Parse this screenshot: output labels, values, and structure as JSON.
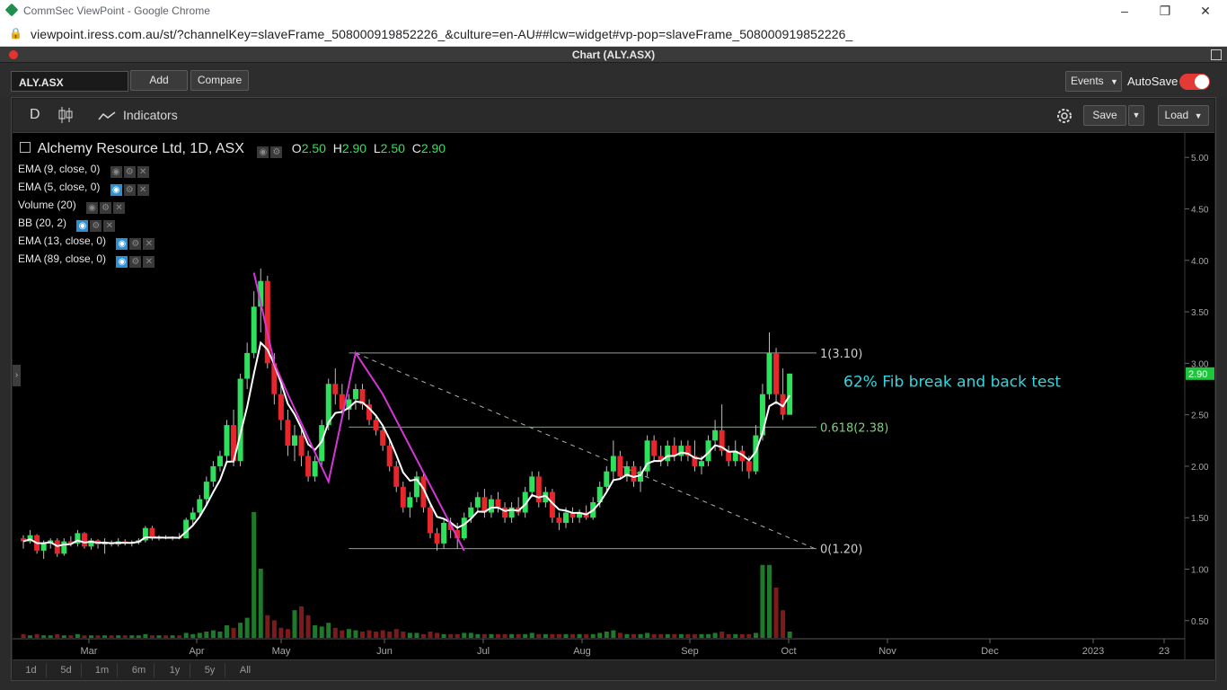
{
  "browser": {
    "window_title": "CommSec ViewPoint - Google Chrome",
    "url": "viewpoint.iress.com.au/st/?channelKey=slaveFrame_508000919852226_&culture=en-AU##lcw=widget#vp-pop=slaveFrame_508000919852226_"
  },
  "app": {
    "panel_title": "Chart (ALY.ASX)"
  },
  "toolbar": {
    "symbol": "ALY.ASX",
    "add_label": "Add",
    "compare_label": "Compare",
    "events_label": "Events",
    "autosave_label": "AutoSave",
    "autosave_on": true
  },
  "chart_toolbar": {
    "interval": "D",
    "indicators_label": "Indicators",
    "save_label": "Save",
    "load_label": "Load"
  },
  "legend": {
    "instrument": "Alchemy Resource Ltd, 1D, ASX",
    "ohlc": {
      "o_label": "O",
      "o": "2.50",
      "h_label": "H",
      "h": "2.90",
      "l_label": "L",
      "l": "2.50",
      "c_label": "C",
      "c": "2.90"
    },
    "studies": [
      {
        "label": "EMA (9, close, 0)",
        "visible": false
      },
      {
        "label": "EMA (5, close, 0)",
        "visible": true
      },
      {
        "label": "Volume (20)",
        "visible": false
      },
      {
        "label": "BB (20, 2)",
        "visible": true
      },
      {
        "label": "EMA (13, close, 0)",
        "visible": true
      },
      {
        "label": "EMA (89, close, 0)",
        "visible": true
      }
    ]
  },
  "range_buttons": [
    "1d",
    "5d",
    "1m",
    "6m",
    "1y",
    "5y",
    "All"
  ],
  "colors": {
    "up": "#2ee05c",
    "down": "#e8262c",
    "ema": "#ffffff",
    "trend": "#d636d6",
    "fib_text": "#cfcfcf",
    "annotation": "#2fd8e0",
    "price_tag": "#20c53e"
  },
  "chart_data": {
    "type": "candlestick",
    "y_ticks": [
      "5.00",
      "4.50",
      "4.00",
      "3.50",
      "3.00",
      "2.50",
      "2.00",
      "1.50",
      "1.00",
      "0.50"
    ],
    "ylim": [
      0.35,
      5.15
    ],
    "x_ticks": [
      "Mar",
      "Apr",
      "May",
      "Jun",
      "Jul",
      "Aug",
      "Sep",
      "Oct",
      "Nov",
      "Dec",
      "2023",
      "23"
    ],
    "last_price": "2.90",
    "fib_levels": [
      {
        "label": "1(3.10)",
        "value": 3.1
      },
      {
        "label": "0.618(2.38)",
        "value": 2.38
      },
      {
        "label": "0(1.20)",
        "value": 1.2
      }
    ],
    "annotation": "62% Fib break and back test",
    "candles": [
      [
        1.3,
        1.33,
        1.2,
        1.27
      ],
      [
        1.27,
        1.38,
        1.25,
        1.33
      ],
      [
        1.33,
        1.34,
        1.15,
        1.18
      ],
      [
        1.18,
        1.28,
        1.1,
        1.25
      ],
      [
        1.25,
        1.3,
        1.2,
        1.28
      ],
      [
        1.28,
        1.3,
        1.12,
        1.15
      ],
      [
        1.15,
        1.3,
        1.13,
        1.27
      ],
      [
        1.27,
        1.32,
        1.22,
        1.25
      ],
      [
        1.25,
        1.38,
        1.22,
        1.35
      ],
      [
        1.35,
        1.36,
        1.2,
        1.22
      ],
      [
        1.22,
        1.3,
        1.19,
        1.28
      ],
      [
        1.28,
        1.29,
        1.2,
        1.24
      ],
      [
        1.24,
        1.3,
        1.15,
        1.26
      ],
      [
        1.26,
        1.28,
        1.22,
        1.24
      ],
      [
        1.24,
        1.3,
        1.22,
        1.27
      ],
      [
        1.27,
        1.29,
        1.23,
        1.25
      ],
      [
        1.25,
        1.28,
        1.22,
        1.26
      ],
      [
        1.26,
        1.3,
        1.24,
        1.28
      ],
      [
        1.28,
        1.42,
        1.26,
        1.4
      ],
      [
        1.4,
        1.42,
        1.28,
        1.3
      ],
      [
        1.3,
        1.33,
        1.28,
        1.31
      ],
      [
        1.31,
        1.33,
        1.29,
        1.3
      ],
      [
        1.3,
        1.32,
        1.28,
        1.31
      ],
      [
        1.31,
        1.35,
        1.29,
        1.3
      ],
      [
        1.3,
        1.5,
        1.3,
        1.48
      ],
      [
        1.48,
        1.6,
        1.42,
        1.55
      ],
      [
        1.55,
        1.72,
        1.5,
        1.68
      ],
      [
        1.68,
        1.9,
        1.62,
        1.85
      ],
      [
        1.85,
        2.05,
        1.8,
        2.0
      ],
      [
        2.0,
        2.15,
        1.95,
        2.1
      ],
      [
        2.1,
        2.45,
        2.05,
        2.4
      ],
      [
        2.4,
        2.55,
        2.0,
        2.05
      ],
      [
        2.05,
        2.9,
        2.0,
        2.85
      ],
      [
        2.85,
        3.2,
        2.75,
        3.1
      ],
      [
        3.1,
        3.7,
        3.05,
        3.55
      ],
      [
        3.55,
        3.92,
        3.3,
        3.8
      ],
      [
        3.8,
        3.85,
        2.95,
        3.0
      ],
      [
        3.0,
        3.1,
        2.6,
        2.7
      ],
      [
        2.7,
        2.8,
        2.35,
        2.45
      ],
      [
        2.45,
        2.55,
        2.1,
        2.2
      ],
      [
        2.2,
        2.4,
        2.05,
        2.3
      ],
      [
        2.3,
        2.35,
        2.0,
        2.1
      ],
      [
        2.1,
        2.15,
        1.85,
        1.9
      ],
      [
        1.9,
        2.1,
        1.85,
        2.05
      ],
      [
        2.05,
        2.45,
        2.0,
        2.4
      ],
      [
        2.4,
        2.85,
        2.35,
        2.8
      ],
      [
        2.8,
        2.95,
        2.6,
        2.7
      ],
      [
        2.7,
        2.8,
        2.5,
        2.55
      ],
      [
        2.55,
        2.7,
        2.45,
        2.65
      ],
      [
        2.65,
        2.8,
        2.55,
        2.75
      ],
      [
        2.75,
        2.8,
        2.55,
        2.6
      ],
      [
        2.6,
        2.65,
        2.4,
        2.45
      ],
      [
        2.45,
        2.5,
        2.3,
        2.35
      ],
      [
        2.35,
        2.4,
        2.15,
        2.2
      ],
      [
        2.2,
        2.25,
        1.95,
        2.0
      ],
      [
        2.0,
        2.05,
        1.75,
        1.8
      ],
      [
        1.8,
        1.85,
        1.55,
        1.6
      ],
      [
        1.6,
        1.75,
        1.5,
        1.7
      ],
      [
        1.7,
        1.95,
        1.65,
        1.9
      ],
      [
        1.9,
        1.95,
        1.55,
        1.6
      ],
      [
        1.6,
        1.62,
        1.3,
        1.35
      ],
      [
        1.35,
        1.4,
        1.18,
        1.25
      ],
      [
        1.25,
        1.48,
        1.2,
        1.45
      ],
      [
        1.45,
        1.5,
        1.3,
        1.38
      ],
      [
        1.38,
        1.45,
        1.2,
        1.3
      ],
      [
        1.3,
        1.55,
        1.28,
        1.5
      ],
      [
        1.5,
        1.65,
        1.45,
        1.6
      ],
      [
        1.6,
        1.75,
        1.55,
        1.7
      ],
      [
        1.7,
        1.78,
        1.5,
        1.55
      ],
      [
        1.55,
        1.72,
        1.5,
        1.68
      ],
      [
        1.68,
        1.75,
        1.55,
        1.6
      ],
      [
        1.6,
        1.65,
        1.45,
        1.5
      ],
      [
        1.5,
        1.65,
        1.45,
        1.6
      ],
      [
        1.6,
        1.7,
        1.52,
        1.55
      ],
      [
        1.55,
        1.8,
        1.5,
        1.75
      ],
      [
        1.75,
        1.95,
        1.7,
        1.9
      ],
      [
        1.9,
        1.95,
        1.6,
        1.65
      ],
      [
        1.65,
        1.8,
        1.6,
        1.75
      ],
      [
        1.75,
        1.78,
        1.45,
        1.5
      ],
      [
        1.5,
        1.55,
        1.38,
        1.45
      ],
      [
        1.45,
        1.6,
        1.4,
        1.55
      ],
      [
        1.55,
        1.6,
        1.45,
        1.5
      ],
      [
        1.5,
        1.58,
        1.45,
        1.55
      ],
      [
        1.55,
        1.62,
        1.48,
        1.5
      ],
      [
        1.5,
        1.7,
        1.48,
        1.65
      ],
      [
        1.65,
        1.85,
        1.6,
        1.8
      ],
      [
        1.8,
        2.0,
        1.75,
        1.95
      ],
      [
        1.95,
        2.25,
        1.85,
        2.1
      ],
      [
        2.1,
        2.15,
        1.88,
        1.9
      ],
      [
        1.9,
        2.05,
        1.85,
        2.0
      ],
      [
        2.0,
        2.05,
        1.8,
        1.85
      ],
      [
        1.85,
        2.0,
        1.75,
        1.95
      ],
      [
        1.95,
        2.3,
        1.9,
        2.25
      ],
      [
        2.25,
        2.3,
        2.05,
        2.1
      ],
      [
        2.1,
        2.2,
        2.0,
        2.05
      ],
      [
        2.05,
        2.25,
        2.0,
        2.2
      ],
      [
        2.2,
        2.28,
        2.05,
        2.1
      ],
      [
        2.1,
        2.25,
        2.05,
        2.2
      ],
      [
        2.2,
        2.25,
        2.05,
        2.1
      ],
      [
        2.1,
        2.25,
        1.95,
        2.0
      ],
      [
        2.0,
        2.1,
        1.92,
        2.05
      ],
      [
        2.05,
        2.3,
        2.0,
        2.25
      ],
      [
        2.25,
        2.45,
        2.15,
        2.35
      ],
      [
        2.35,
        2.6,
        2.1,
        2.15
      ],
      [
        2.15,
        2.2,
        2.0,
        2.05
      ],
      [
        2.05,
        2.25,
        2.0,
        2.15
      ],
      [
        2.15,
        2.2,
        1.95,
        2.05
      ],
      [
        2.05,
        2.1,
        1.88,
        1.95
      ],
      [
        1.95,
        2.4,
        1.92,
        2.3
      ],
      [
        2.3,
        2.8,
        2.25,
        2.7
      ],
      [
        2.7,
        3.3,
        2.65,
        3.1
      ],
      [
        3.1,
        3.15,
        2.6,
        2.7
      ],
      [
        2.7,
        2.95,
        2.45,
        2.5
      ],
      [
        2.5,
        2.9,
        2.5,
        2.9
      ]
    ],
    "volumes": [
      0.03,
      0.02,
      0.03,
      0.02,
      0.02,
      0.03,
      0.02,
      0.02,
      0.03,
      0.02,
      0.02,
      0.02,
      0.02,
      0.02,
      0.02,
      0.02,
      0.02,
      0.02,
      0.03,
      0.02,
      0.02,
      0.02,
      0.02,
      0.02,
      0.04,
      0.03,
      0.04,
      0.05,
      0.06,
      0.05,
      0.1,
      0.08,
      0.12,
      0.16,
      1.0,
      0.55,
      0.18,
      0.14,
      0.08,
      0.07,
      0.22,
      0.25,
      0.18,
      0.1,
      0.09,
      0.12,
      0.08,
      0.06,
      0.07,
      0.06,
      0.05,
      0.06,
      0.05,
      0.06,
      0.05,
      0.07,
      0.05,
      0.04,
      0.04,
      0.03,
      0.05,
      0.04,
      0.03,
      0.03,
      0.03,
      0.04,
      0.04,
      0.03,
      0.03,
      0.03,
      0.03,
      0.03,
      0.03,
      0.03,
      0.03,
      0.04,
      0.03,
      0.03,
      0.03,
      0.03,
      0.03,
      0.03,
      0.03,
      0.03,
      0.03,
      0.04,
      0.05,
      0.06,
      0.04,
      0.03,
      0.03,
      0.03,
      0.04,
      0.03,
      0.03,
      0.03,
      0.03,
      0.03,
      0.03,
      0.03,
      0.03,
      0.03,
      0.04,
      0.05,
      0.03,
      0.03,
      0.03,
      0.03,
      0.04,
      0.58,
      0.58,
      0.4,
      0.22,
      0.05
    ]
  }
}
